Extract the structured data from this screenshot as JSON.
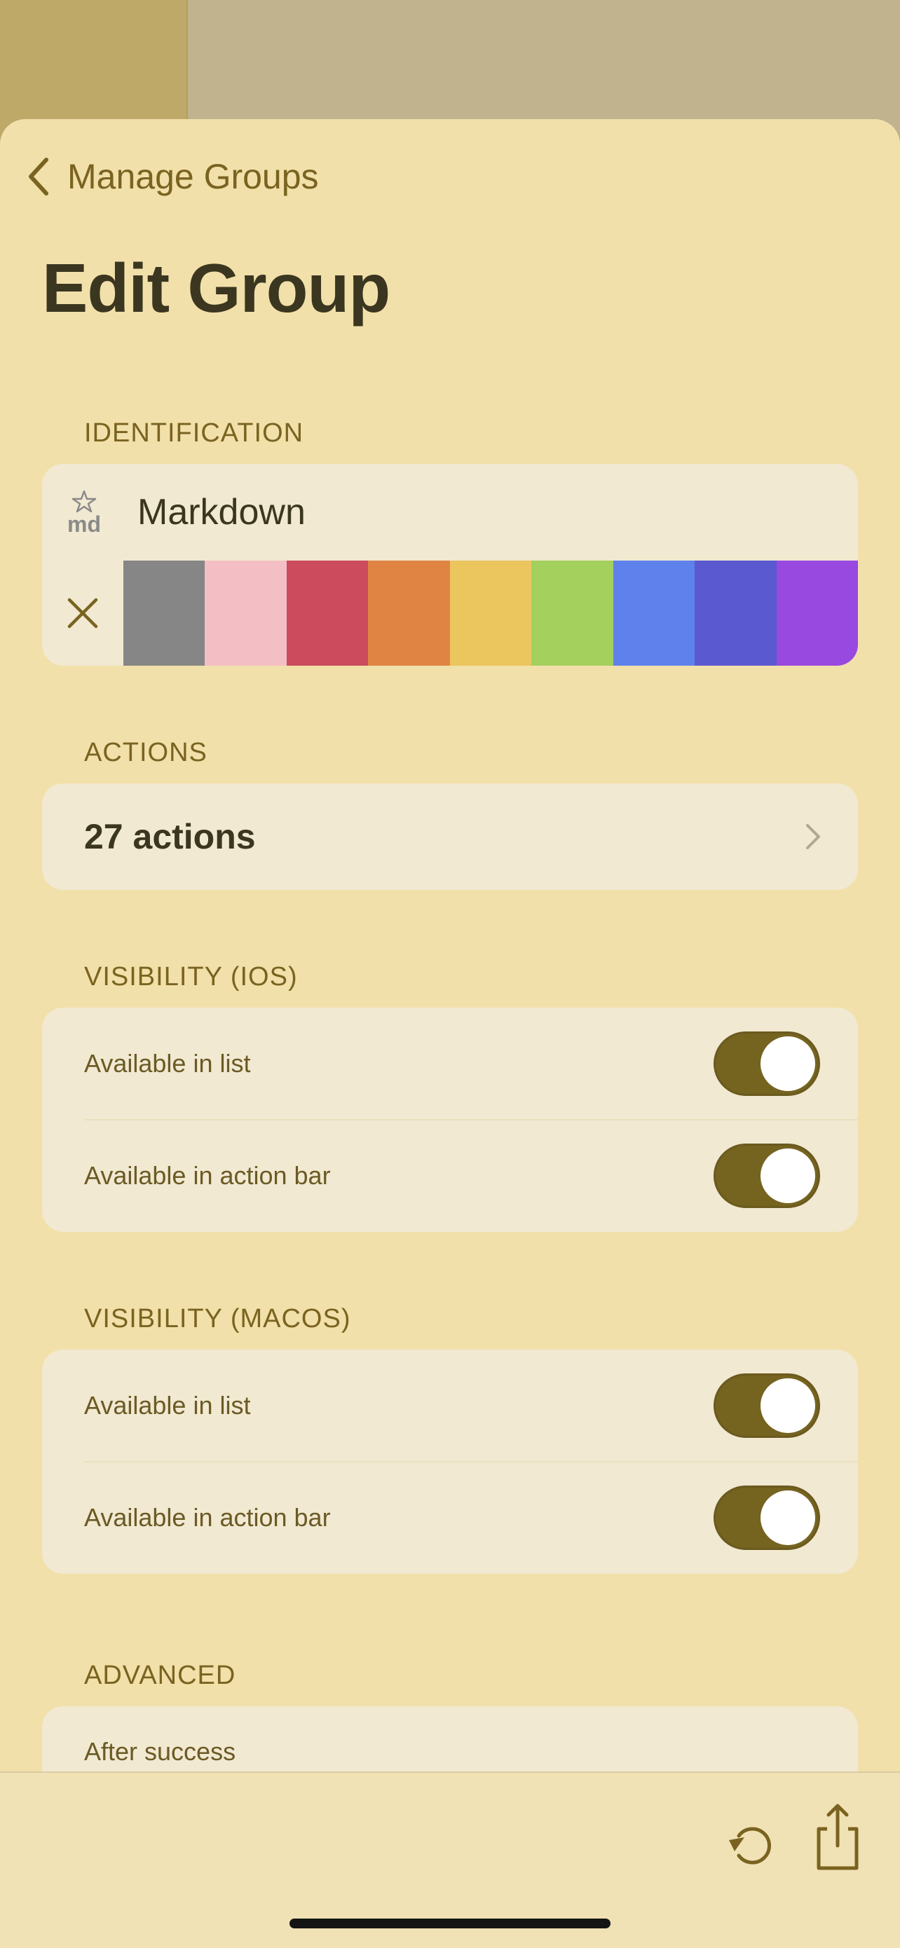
{
  "nav": {
    "back_label": "Manage Groups",
    "title": "Edit Group"
  },
  "identification": {
    "section_label": "IDENTIFICATION",
    "name": "Markdown",
    "icon": "md-star-icon",
    "colors": [
      "#868686",
      "#f4bfc4",
      "#cc4b5c",
      "#e08444",
      "#ebc65f",
      "#a4d05e",
      "#5e81ec",
      "#5a59d0",
      "#9849e0"
    ]
  },
  "actions": {
    "section_label": "ACTIONS",
    "count_label": "27 actions"
  },
  "visibility_ios": {
    "section_label": "VISIBILITY (IOS)",
    "rows": [
      {
        "label": "Available in list",
        "on": true
      },
      {
        "label": "Available in action bar",
        "on": true
      }
    ]
  },
  "visibility_macos": {
    "section_label": "VISIBILITY (MACOS)",
    "rows": [
      {
        "label": "Available in list",
        "on": true
      },
      {
        "label": "Available in action bar",
        "on": true
      }
    ]
  },
  "advanced": {
    "section_label": "ADVANCED",
    "first_row_label": "After success"
  },
  "toolbar": {
    "accent": "#7a6320",
    "icons": [
      "undo-icon",
      "share-icon"
    ]
  }
}
